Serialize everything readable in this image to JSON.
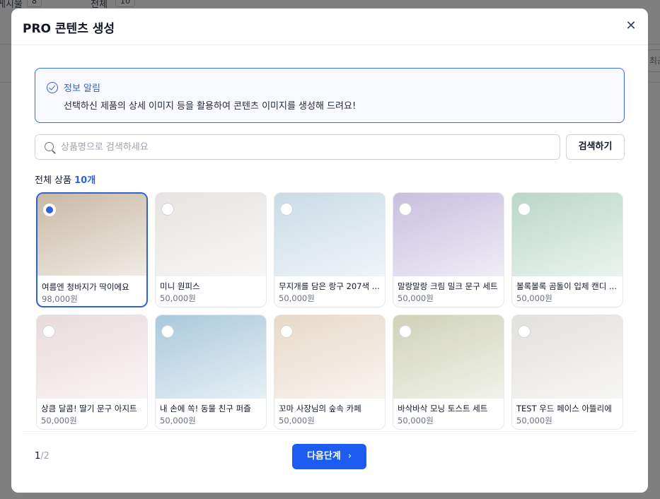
{
  "background": {
    "label_left": "게시물",
    "pill_left": "8",
    "label_mid": "전체",
    "pill_mid": "10",
    "right_button": "최근"
  },
  "modal": {
    "title": "PRO 콘텐츠 생성",
    "close_icon": "close-icon"
  },
  "notice": {
    "icon": "check-circle-icon",
    "title": "정보 알림",
    "text": "선택하신 제품의 상세 이미지 등을 활용하여 콘텐츠 이미지를 생성해 드려요!"
  },
  "search": {
    "placeholder": "상품명으로 검색하세요",
    "value": "",
    "button_label": "검색하기"
  },
  "count": {
    "label": "전체 상품",
    "value": "10개"
  },
  "products": [
    {
      "name": "여름엔 청바지가 딱이에요",
      "price": "98,000원",
      "selected": true,
      "color": "#c9b9a4"
    },
    {
      "name": "미니 원피스",
      "price": "50,000원",
      "selected": false,
      "color": "#e6e3e0"
    },
    {
      "name": "무지개를 담은 랑구 207색 ...",
      "price": "50,000원",
      "selected": false,
      "color": "#c9dbe6"
    },
    {
      "name": "말랑말랑 크림 밀크 문구 세트",
      "price": "50,000원",
      "selected": false,
      "color": "#c8bedf"
    },
    {
      "name": "볼록볼록 곰돌이 입체 캔디 ...",
      "price": "50,000원",
      "selected": false,
      "color": "#b9d7c8"
    },
    {
      "name": "상큼 달콤! 딸기 문구 아지트",
      "price": "50,000원",
      "selected": false,
      "color": "#e9dadc"
    },
    {
      "name": "내 손에 쏙! 동물 친구 퍼즐",
      "price": "50,000원",
      "selected": false,
      "color": "#a9c9dc"
    },
    {
      "name": "꼬마 사장님의 숲속 카페",
      "price": "50,000원",
      "selected": false,
      "color": "#e7d9c8"
    },
    {
      "name": "바삭바삭 모닝 토스트 세트",
      "price": "50,000원",
      "selected": false,
      "color": "#cfd2b6"
    },
    {
      "name": "TEST 우드 페이스 아뜰리에",
      "price": "50,000원",
      "selected": false,
      "color": "#e2e0dc"
    }
  ],
  "pager": {
    "current": "1",
    "separator": "/",
    "total": "2"
  },
  "next_button": {
    "label": "다음단계",
    "icon": "chevron-right-icon"
  },
  "colors": {
    "accent": "#1d5cf0",
    "notice_border": "#3b6fe0"
  }
}
